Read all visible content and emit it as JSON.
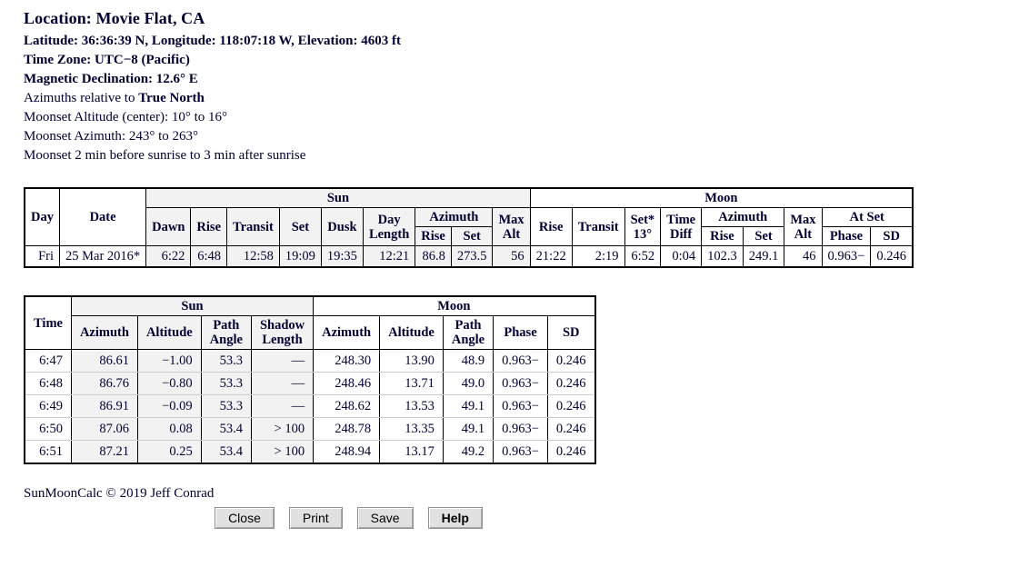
{
  "header": {
    "location_label": "Location: Movie Flat, CA",
    "coords_line": "Latitude: 36:36:39 N, Longitude: 118:07:18 W, Elevation: 4603 ft",
    "timezone_line": "Time Zone: UTC−8 (Pacific)",
    "declination_line": "Magnetic Declination: 12.6° E",
    "azimuth_ref_prefix": "Azimuths relative to ",
    "azimuth_ref_value": "True North",
    "moonset_altitude_line": "Moonset Altitude (center): 10° to 16°",
    "moonset_azimuth_line": "Moonset Azimuth: 243° to 263°",
    "moonset_timing_line": "Moonset 2 min before sunrise to 3 min after sunrise"
  },
  "summary_table": {
    "groups": {
      "sun": "Sun",
      "moon": "Moon"
    },
    "headers": {
      "day": "Day",
      "date": "Date",
      "sun_dawn": "Dawn",
      "sun_rise": "Rise",
      "sun_transit": "Transit",
      "sun_set": "Set",
      "sun_dusk": "Dusk",
      "sun_day_length_l1": "Day",
      "sun_day_length_l2": "Length",
      "sun_azimuth": "Azimuth",
      "sun_azimuth_rise": "Rise",
      "sun_azimuth_set": "Set",
      "sun_max_alt_l1": "Max",
      "sun_max_alt_l2": "Alt",
      "moon_rise": "Rise",
      "moon_transit": "Transit",
      "moon_set_l1": "Set*",
      "moon_set_l2": "13°",
      "moon_time_diff_l1": "Time",
      "moon_time_diff_l2": "Diff",
      "moon_azimuth": "Azimuth",
      "moon_azimuth_rise": "Rise",
      "moon_azimuth_set": "Set",
      "moon_max_alt_l1": "Max",
      "moon_max_alt_l2": "Alt",
      "moon_at_set": "At Set",
      "moon_phase": "Phase",
      "moon_sd": "SD"
    },
    "row": {
      "day": "Fri",
      "date": "25 Mar 2016*",
      "sun_dawn": "6:22",
      "sun_rise": "6:48",
      "sun_transit": "12:58",
      "sun_set": "19:09",
      "sun_dusk": "19:35",
      "sun_day_length": "12:21",
      "sun_az_rise": "86.8",
      "sun_az_set": "273.5",
      "sun_max_alt": "56",
      "moon_rise": "21:22",
      "moon_transit": "2:19",
      "moon_set": "6:52",
      "moon_time_diff": "0:04",
      "moon_az_rise": "102.3",
      "moon_az_set": "249.1",
      "moon_max_alt": "46",
      "moon_phase": "0.963−",
      "moon_sd": "0.246"
    }
  },
  "detail_table": {
    "groups": {
      "sun": "Sun",
      "moon": "Moon"
    },
    "headers": {
      "time": "Time",
      "sun_azimuth": "Azimuth",
      "sun_altitude": "Altitude",
      "sun_path_angle_l1": "Path",
      "sun_path_angle_l2": "Angle",
      "sun_shadow_l1": "Shadow",
      "sun_shadow_l2": "Length",
      "moon_azimuth": "Azimuth",
      "moon_altitude": "Altitude",
      "moon_path_angle_l1": "Path",
      "moon_path_angle_l2": "Angle",
      "moon_phase": "Phase",
      "moon_sd": "SD"
    },
    "rows": [
      {
        "time": "6:47",
        "sun_az": "86.61",
        "sun_alt": "−1.00",
        "sun_pa": "53.3",
        "shadow": "—",
        "moon_az": "248.30",
        "moon_alt": "13.90",
        "moon_pa": "48.9",
        "phase": "0.963−",
        "sd": "0.246"
      },
      {
        "time": "6:48",
        "sun_az": "86.76",
        "sun_alt": "−0.80",
        "sun_pa": "53.3",
        "shadow": "—",
        "moon_az": "248.46",
        "moon_alt": "13.71",
        "moon_pa": "49.0",
        "phase": "0.963−",
        "sd": "0.246"
      },
      {
        "time": "6:49",
        "sun_az": "86.91",
        "sun_alt": "−0.09",
        "sun_pa": "53.3",
        "shadow": "—",
        "moon_az": "248.62",
        "moon_alt": "13.53",
        "moon_pa": "49.1",
        "phase": "0.963−",
        "sd": "0.246"
      },
      {
        "time": "6:50",
        "sun_az": "87.06",
        "sun_alt": "0.08",
        "sun_pa": "53.4",
        "shadow": "> 100",
        "moon_az": "248.78",
        "moon_alt": "13.35",
        "moon_pa": "49.1",
        "phase": "0.963−",
        "sd": "0.246"
      },
      {
        "time": "6:51",
        "sun_az": "87.21",
        "sun_alt": "0.25",
        "sun_pa": "53.4",
        "shadow": "> 100",
        "moon_az": "248.94",
        "moon_alt": "13.17",
        "moon_pa": "49.2",
        "phase": "0.963−",
        "sd": "0.246"
      }
    ]
  },
  "footer": {
    "copyright": "SunMoonCalc © 2019 Jeff Conrad",
    "buttons": [
      {
        "label": "Close",
        "bold": false
      },
      {
        "label": "Print",
        "bold": false
      },
      {
        "label": "Save",
        "bold": false
      },
      {
        "label": "Help",
        "bold": true
      }
    ]
  }
}
